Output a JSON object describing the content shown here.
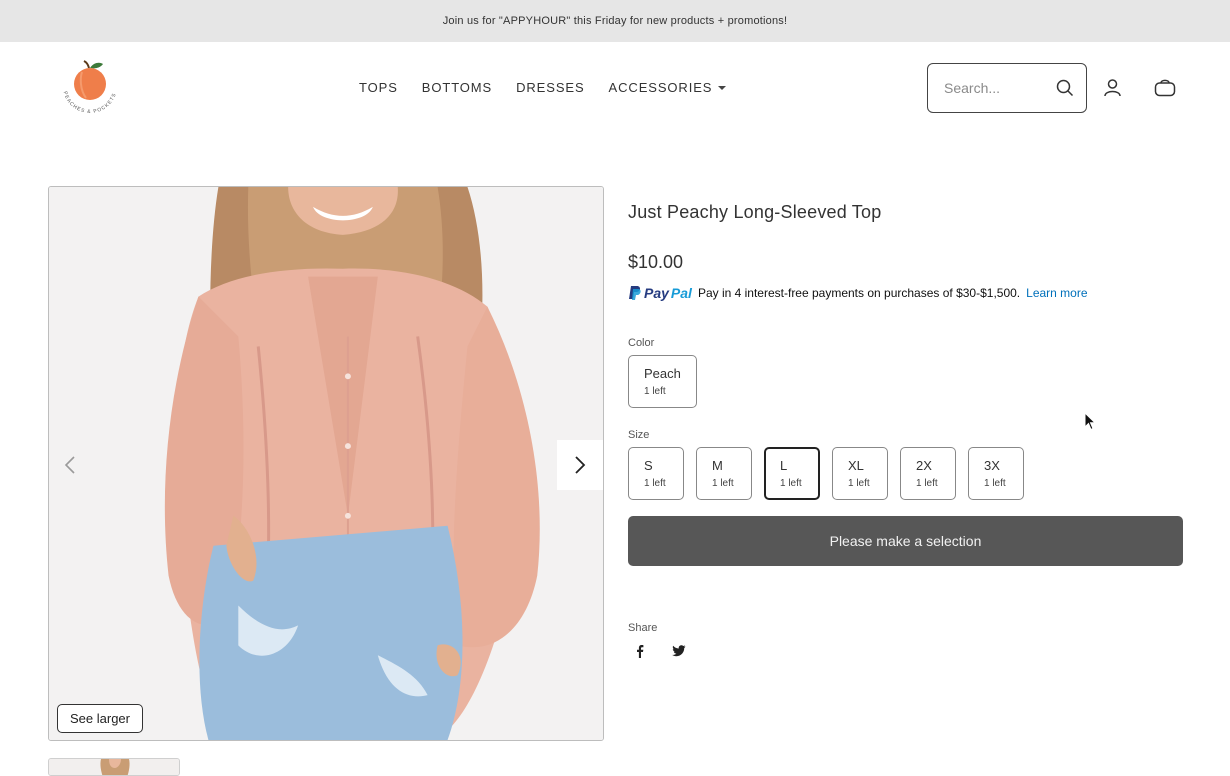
{
  "announcement": "Join us for \"APPYHOUR\" this Friday for new products + promotions!",
  "header": {
    "logo_text": "PEACHES & POCKETS",
    "nav": [
      {
        "label": "TOPS"
      },
      {
        "label": "BOTTOMS"
      },
      {
        "label": "DRESSES"
      },
      {
        "label": "ACCESSORIES"
      }
    ],
    "search_placeholder": "Search...",
    "icons": [
      "search-icon",
      "account-icon",
      "cart-icon"
    ]
  },
  "gallery": {
    "see_larger_label": "See larger",
    "icons": [
      "chevron-left-icon",
      "chevron-right-icon"
    ]
  },
  "product": {
    "title": "Just Peachy Long-Sleeved Top",
    "price": "$10.00",
    "paypal": {
      "logo_pay": "Pay",
      "logo_pal": "Pal",
      "message": "Pay in 4 interest-free payments on purchases of $30-$1,500.",
      "learn_more": "Learn more"
    },
    "color_label": "Color",
    "colors": [
      {
        "name": "Peach",
        "stock": "1 left"
      }
    ],
    "size_label": "Size",
    "sizes": [
      {
        "name": "S",
        "stock": "1 left"
      },
      {
        "name": "M",
        "stock": "1 left"
      },
      {
        "name": "L",
        "stock": "1 left",
        "selected": true
      },
      {
        "name": "XL",
        "stock": "1 left"
      },
      {
        "name": "2X",
        "stock": "1 left"
      },
      {
        "name": "3X",
        "stock": "1 left"
      }
    ],
    "add_button_label": "Please make a selection",
    "share_label": "Share",
    "share_icons": [
      "facebook-icon",
      "twitter-icon"
    ]
  },
  "colors": {
    "announcement_bg": "#e6e6e6",
    "button_bg": "#575757",
    "peach": "#ef7e4a",
    "leaf": "#3d7a3a",
    "paypal_dark": "#253b80",
    "paypal_light": "#179bd7"
  }
}
